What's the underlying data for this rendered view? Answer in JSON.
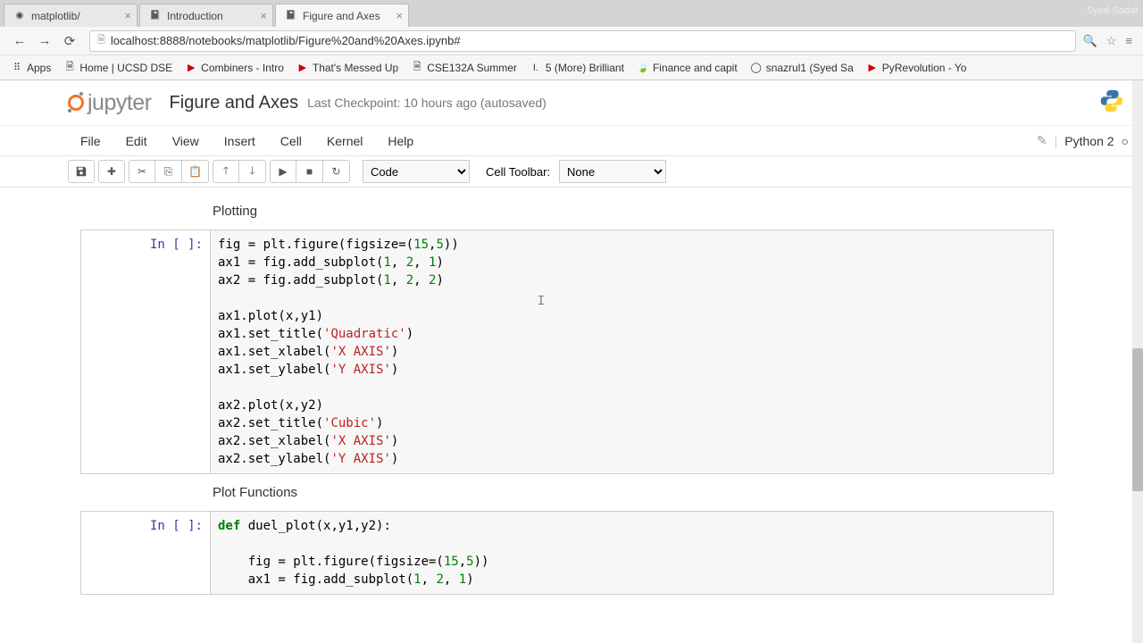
{
  "browser": {
    "tabs": [
      {
        "title": "matplotlib/",
        "active": false
      },
      {
        "title": "Introduction",
        "active": false
      },
      {
        "title": "Figure and Axes",
        "active": true
      }
    ],
    "user_label": "Syed Sadat",
    "url": "localhost:8888/notebooks/matplotlib/Figure%20and%20Axes.ipynb#",
    "bookmarks": [
      {
        "label": "Apps",
        "icon": "⠿"
      },
      {
        "label": "Home | UCSD DSE",
        "icon": "🗎"
      },
      {
        "label": "Combiners - Intro",
        "icon": "▶"
      },
      {
        "label": "That's Messed Up",
        "icon": "▶"
      },
      {
        "label": "CSE132A Summer",
        "icon": "🗎"
      },
      {
        "label": "5 (More) Brilliant",
        "icon": "I."
      },
      {
        "label": "Finance and capit",
        "icon": "🍃"
      },
      {
        "label": "snazrul1 (Syed Sa",
        "icon": "◯"
      },
      {
        "label": "PyRevolution - Yo",
        "icon": "▶"
      }
    ]
  },
  "jupyter": {
    "logo_text": "jupyter",
    "title": "Figure and Axes",
    "checkpoint": "Last Checkpoint: 10 hours ago (autosaved)",
    "menus": [
      "File",
      "Edit",
      "View",
      "Insert",
      "Cell",
      "Kernel",
      "Help"
    ],
    "kernel_name": "Python 2",
    "celltype": "Code",
    "cell_toolbar_label": "Cell Toolbar:",
    "cell_toolbar": "None"
  },
  "notebook": {
    "heading1": "Plotting",
    "heading2": "Plot Functions",
    "prompt1": "In [ ]:",
    "prompt2": "In [ ]:",
    "code1_lines": [
      "fig = plt.figure(figsize=(15,5))",
      "ax1 = fig.add_subplot(1, 2, 1)",
      "ax2 = fig.add_subplot(1, 2, 2)",
      "",
      "ax1.plot(x,y1)",
      "ax1.set_title('Quadratic')",
      "ax1.set_xlabel('X AXIS')",
      "ax1.set_ylabel('Y AXIS')",
      "",
      "ax2.plot(x,y2)",
      "ax2.set_title('Cubic')",
      "ax2.set_xlabel('X AXIS')",
      "ax2.set_ylabel('Y AXIS')"
    ],
    "code2_lines": [
      "def duel_plot(x,y1,y2):",
      "",
      "    fig = plt.figure(figsize=(15,5))",
      "    ax1 = fig.add_subplot(1, 2, 1)"
    ]
  }
}
